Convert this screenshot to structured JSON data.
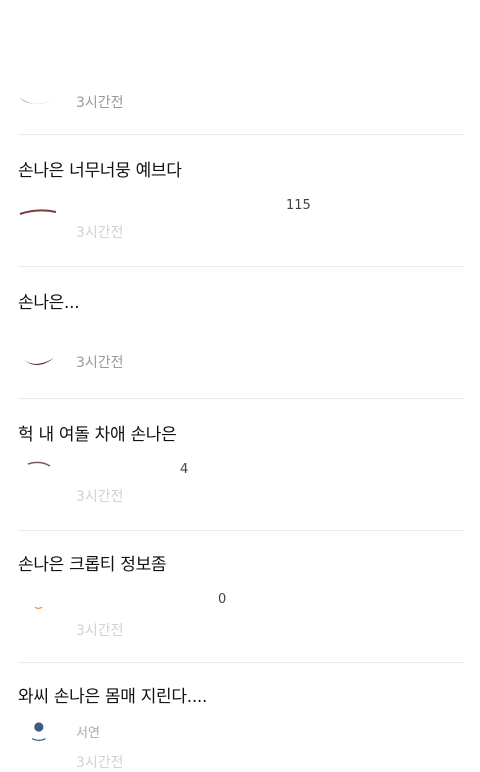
{
  "posts": [
    {
      "title": "",
      "meta_fragment": "",
      "time": "3시간전"
    },
    {
      "title": "손나은 너무너뭉 예브다",
      "meta_fragment": "115",
      "time": "3시간전"
    },
    {
      "title": "손나은...",
      "meta_fragment": "",
      "time": "3시간전"
    },
    {
      "title": "헉 내 여돌 차애 손나은",
      "meta_fragment": "4",
      "time": "3시간전"
    },
    {
      "title": "손나은 크롭티 정보좀",
      "meta_fragment": "0",
      "time": "3시간전"
    },
    {
      "title": "와씨 손나은 몸매 지린다....",
      "meta_fragment": "서연",
      "time": "3시간전"
    }
  ],
  "colors": {
    "divider": "#ececec",
    "time_text": "#9a9a9a",
    "title_text": "#111111"
  }
}
